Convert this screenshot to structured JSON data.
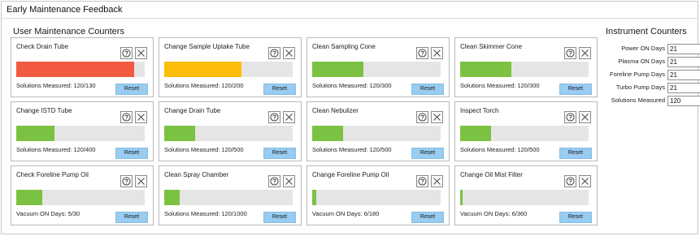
{
  "window": {
    "title": "Early Maintenance Feedback"
  },
  "user_counters": {
    "title": "User Maintenance Counters",
    "reset_label": "Reset",
    "cards": [
      {
        "title": "Check Drain Tube",
        "status": "Solutions Measured: 120/130",
        "fill_fraction": 0.92,
        "color": "red"
      },
      {
        "title": "Change Sample Uptake Tube",
        "status": "Solutions Measured: 120/200",
        "fill_fraction": 0.6,
        "color": "yellow"
      },
      {
        "title": "Clean Sampling Cone",
        "status": "Solutions Measured: 120/300",
        "fill_fraction": 0.4,
        "color": "green"
      },
      {
        "title": "Clean Skimmer Cone",
        "status": "Solutions Measured: 120/300",
        "fill_fraction": 0.4,
        "color": "green"
      },
      {
        "title": "Change ISTD Tube",
        "status": "Solutions Measured: 120/400",
        "fill_fraction": 0.3,
        "color": "green"
      },
      {
        "title": "Change Drain Tube",
        "status": "Solutions Measured: 120/500",
        "fill_fraction": 0.24,
        "color": "green"
      },
      {
        "title": "Clean Nebulizer",
        "status": "Solutions Measured: 120/500",
        "fill_fraction": 0.24,
        "color": "green"
      },
      {
        "title": "Inspect Torch",
        "status": "Solutions Measured: 120/500",
        "fill_fraction": 0.24,
        "color": "green"
      },
      {
        "title": "Check Foreline Pump Oil",
        "status": "Vacuum ON Days: 5/30",
        "fill_fraction": 0.2,
        "color": "green"
      },
      {
        "title": "Clean Spray Chamber",
        "status": "Solutions Measured: 120/1000",
        "fill_fraction": 0.12,
        "color": "green"
      },
      {
        "title": "Change Foreline Pump Oil",
        "status": "Vacuum ON Days: 6/180",
        "fill_fraction": 0.033,
        "color": "green"
      },
      {
        "title": "Change Oil Mist Filter",
        "status": "Vacuum ON Days: 6/360",
        "fill_fraction": 0.017,
        "color": "green"
      }
    ]
  },
  "instrument_counters": {
    "title": "Instrument Counters",
    "rows": [
      {
        "label": "Power ON Days",
        "value": "21"
      },
      {
        "label": "Plasma ON Days",
        "value": "21"
      },
      {
        "label": "Foreline Pump Days",
        "value": "21"
      },
      {
        "label": "Turbo Pump Days",
        "value": "21"
      },
      {
        "label": "Solutions Measured",
        "value": "120"
      }
    ]
  },
  "colors": {
    "red": "#f15a3f",
    "yellow": "#fbbd09",
    "green": "#7cc242",
    "reset_button": "#98ccf0"
  },
  "icons": {
    "help": "help-circle-icon",
    "close": "close-x-icon"
  }
}
